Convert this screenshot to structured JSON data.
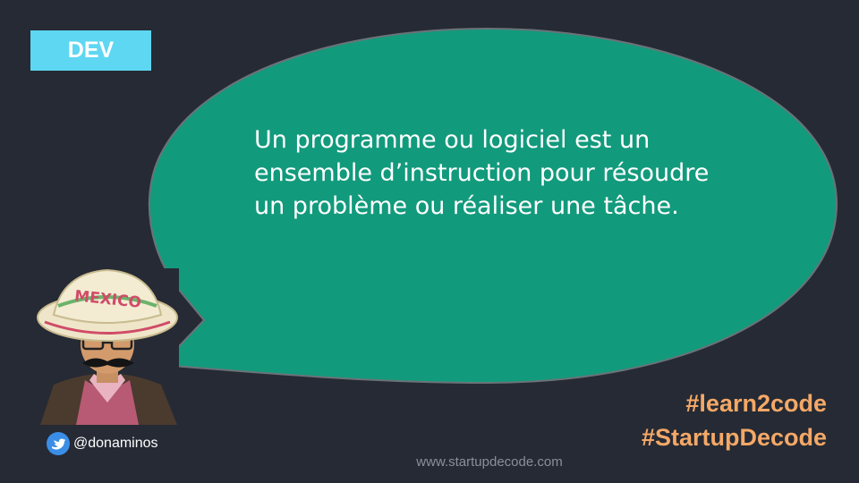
{
  "badge": {
    "label": "DEV"
  },
  "bubble": {
    "text": "Un programme ou logiciel est un ensemble d’instruction pour résoudre un problème ou réaliser une tâche.",
    "fill_color": "#129a7c",
    "stroke_color": "#6b7378"
  },
  "avatar": {
    "hat_text": "MEXICO",
    "hat_icon": "sombrero-icon"
  },
  "social": {
    "icon": "twitter-bird-icon",
    "handle": "@donaminos"
  },
  "hashtags": [
    "#learn2code",
    "#StartupDecode"
  ],
  "footer": {
    "website": "www.startupdecode.com"
  },
  "colors": {
    "background": "#252a34",
    "badge": "#5ed7f2",
    "hashtag": "#f4a867",
    "footer_text": "#8b8f97"
  }
}
